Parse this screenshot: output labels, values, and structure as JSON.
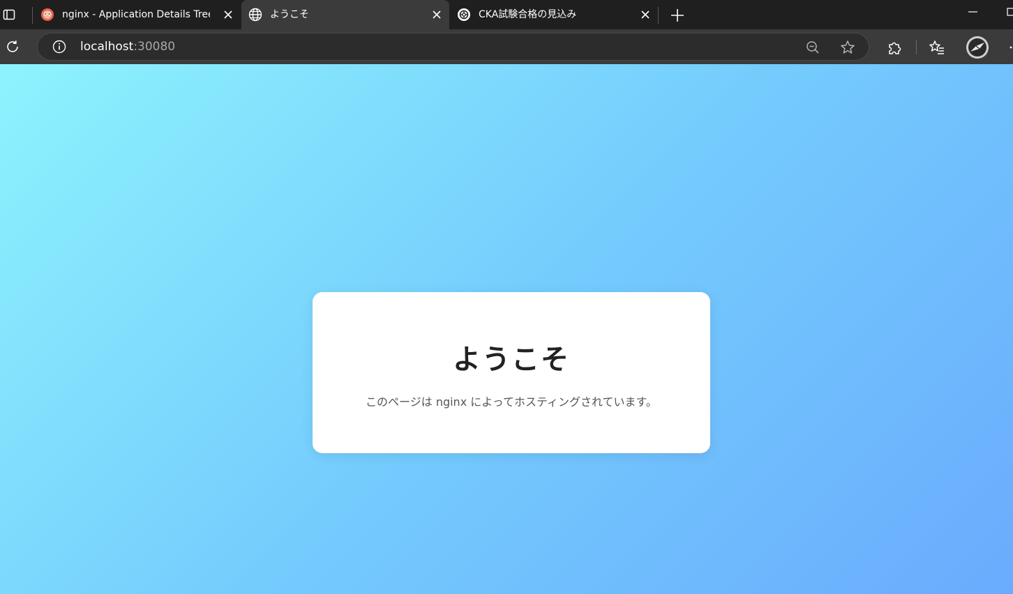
{
  "browser": {
    "tabs": [
      {
        "title": "nginx - Application Details Tree - A",
        "favicon": "argo-octopus-icon",
        "active": false
      },
      {
        "title": "ようこそ",
        "favicon": "globe-icon",
        "active": true
      },
      {
        "title": "CKA試験合格の見込み",
        "favicon": "chatgpt-icon",
        "active": false
      }
    ],
    "address": {
      "host": "localhost",
      "port": ":30080"
    },
    "colors": {
      "tabstrip": "#1f1f1f",
      "toolbar": "#3b3b3b",
      "omnibox": "#2c2c2c"
    }
  },
  "page": {
    "heading": "ようこそ",
    "message": "このページは nginx によってホスティングされています。",
    "gradient": [
      "#8ef3fd",
      "#6aabfd"
    ]
  }
}
